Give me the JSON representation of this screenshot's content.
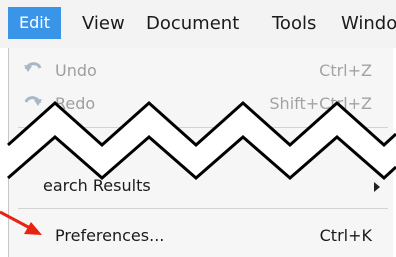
{
  "menubar": {
    "items": [
      {
        "label": "Edit",
        "active": true
      },
      {
        "label": "View"
      },
      {
        "label": "Document"
      },
      {
        "label": "Tools"
      },
      {
        "label": "Windo"
      }
    ]
  },
  "edit_menu": {
    "items": [
      {
        "label": "Undo",
        "shortcut": "Ctrl+Z",
        "disabled": true
      },
      {
        "label": "Redo",
        "shortcut": "Shift+Ctrl+Z",
        "disabled": true
      },
      {
        "label": "Search Results",
        "visible_label": "earch Results",
        "has_submenu": true
      },
      {
        "label": "Preferences...",
        "shortcut": "Ctrl+K"
      }
    ]
  },
  "colors": {
    "menubar_bg": "#f3f3f3",
    "active_highlight": "#3a95e8",
    "dropdown_bg": "#f6f6f6",
    "annotation_arrow": "#e8230f",
    "break_line": "#000000"
  }
}
